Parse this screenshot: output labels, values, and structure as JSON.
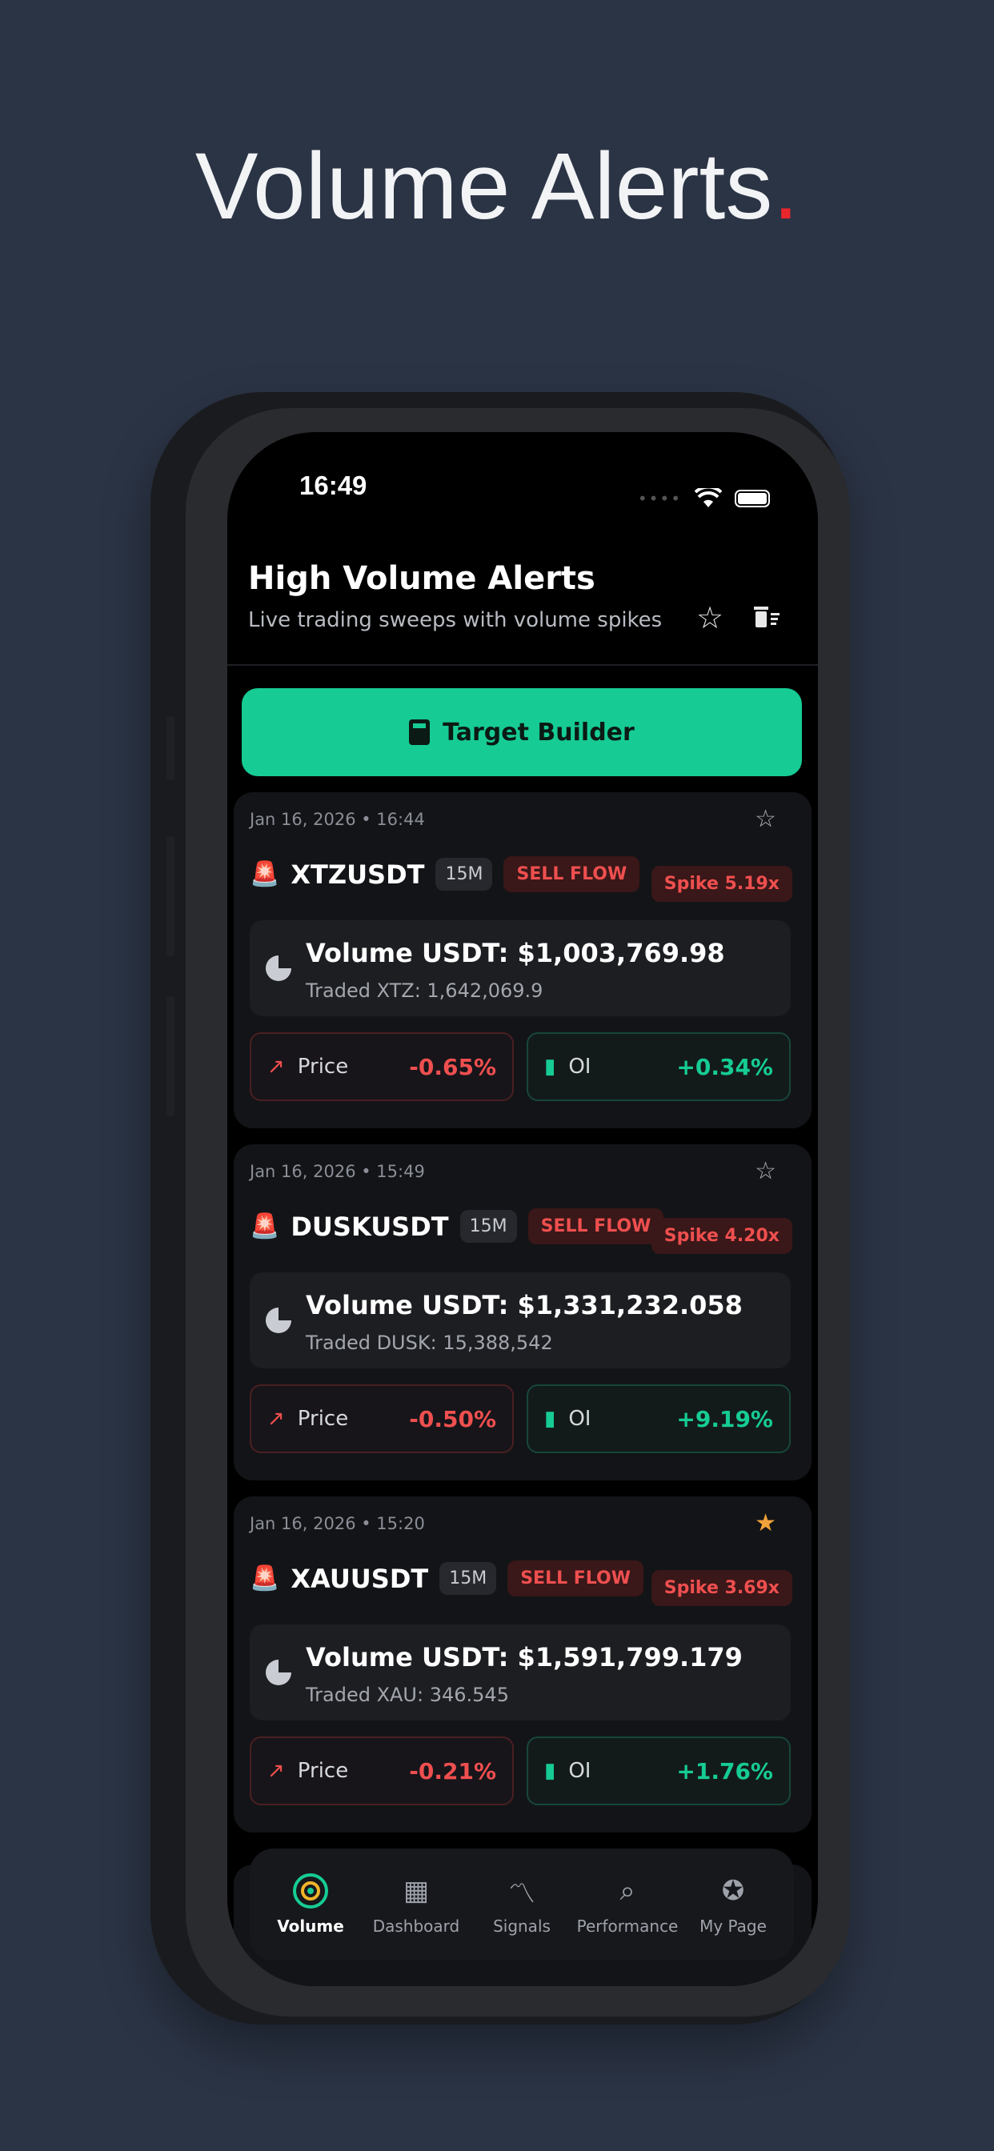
{
  "headline": {
    "text": "Volume Alerts",
    "dot": "."
  },
  "status_bar": {
    "time": "16:49"
  },
  "header": {
    "title": "High Volume Alerts",
    "subtitle": "Live trading sweeps with volume spikes",
    "favorites_icon": "star-icon",
    "clear_icon": "trash-icon"
  },
  "target_builder": {
    "label": "Target Builder",
    "icon": "calculator-icon"
  },
  "alerts": [
    {
      "date": "Jan 16, 2026 • 16:44",
      "symbol": "XTZUSDT",
      "timeframe": "15M",
      "flow": "SELL FLOW",
      "spike": "Spike 5.19x",
      "volume": "Volume USDT: $1,003,769.98",
      "traded": "Traded XTZ: 1,642,069.9",
      "price_label": "Price",
      "price_change": "-0.65%",
      "oi_label": "OI",
      "oi_change": "+0.34%",
      "starred": false
    },
    {
      "date": "Jan 16, 2026 • 15:49",
      "symbol": "DUSKUSDT",
      "timeframe": "15M",
      "flow": "SELL FLOW",
      "spike": "Spike 4.20x",
      "volume": "Volume USDT: $1,331,232.058",
      "traded": "Traded DUSK: 15,388,542",
      "price_label": "Price",
      "price_change": "-0.50%",
      "oi_label": "OI",
      "oi_change": "+9.19%",
      "starred": false
    },
    {
      "date": "Jan 16, 2026 • 15:20",
      "symbol": "XAUUSDT",
      "timeframe": "15M",
      "flow": "SELL FLOW",
      "spike": "Spike 3.69x",
      "volume": "Volume USDT: $1,591,799.179",
      "traded": "Traded XAU: 346.545",
      "price_label": "Price",
      "price_change": "-0.21%",
      "oi_label": "OI",
      "oi_change": "+1.76%",
      "starred": true
    }
  ],
  "tabs": [
    {
      "label": "Volume",
      "icon": "volume-radar-icon",
      "active": true
    },
    {
      "label": "Dashboard",
      "icon": "grid-icon",
      "active": false
    },
    {
      "label": "Signals",
      "icon": "signals-icon",
      "active": false
    },
    {
      "label": "Performance",
      "icon": "performance-icon",
      "active": false
    },
    {
      "label": "My Page",
      "icon": "badge-icon",
      "active": false
    }
  ],
  "colors": {
    "background": "#2b3445",
    "accent_green": "#16cc94",
    "negative_red": "#ef4f4f",
    "star_gold": "#f2a23a"
  }
}
